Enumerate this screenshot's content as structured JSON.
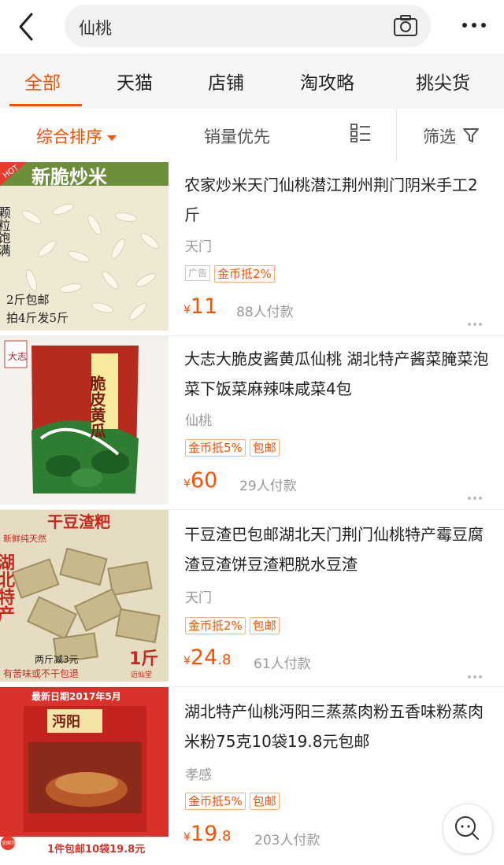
{
  "search": {
    "query": "仙桃"
  },
  "tabs": [
    {
      "label": "全部"
    },
    {
      "label": "天猫"
    },
    {
      "label": "店铺"
    },
    {
      "label": "淘攻略"
    },
    {
      "label": "挑尖货"
    }
  ],
  "sort": {
    "comprehensive": "综合排序",
    "sales": "销量优先",
    "filter": "筛选"
  },
  "products": [
    {
      "title": "农家炒米天门仙桃潜江荆州荆门阴米手工2斤",
      "location": "天门",
      "ad_tag": "广告",
      "tags": [
        "金币抵2%"
      ],
      "currency": "¥",
      "price_int": "11",
      "price_dec": "",
      "buyers": "88人付款",
      "img_text": {
        "title": "新脆炒米",
        "badge": "HOT",
        "side": "颗粒饱满",
        "bottom1": "2斤包邮",
        "bottom2": "拍4斤发5斤"
      }
    },
    {
      "title": "大志大脆皮酱黄瓜仙桃 湖北特产酱菜腌菜泡菜下饭菜麻辣味咸菜4包",
      "location": "仙桃",
      "tags": [
        "金币抵5%",
        "包邮"
      ],
      "currency": "¥",
      "price_int": "60",
      "price_dec": "",
      "buyers": "29人付款",
      "img_text": {
        "package": "脆皮黄瓜",
        "logo": "大志"
      }
    },
    {
      "title": "干豆渣巴包邮湖北天门荆门仙桃特产霉豆腐渣豆渣饼豆渣粑脱水豆渣",
      "location": "天门",
      "tags": [
        "金币抵2%",
        "包邮"
      ],
      "currency": "¥",
      "price_int": "24",
      "price_dec": ".8",
      "buyers": "61人付款",
      "img_text": {
        "title": "干豆渣粑",
        "side": "湖北特产",
        "top_small": "新鲜纯天然",
        "weight": "1斤",
        "promo": "两斤减3元",
        "note": "有苦味或不干包退",
        "shop": "迈仙堂"
      }
    },
    {
      "title": "湖北特产仙桃沔阳三蒸蒸肉粉五香味粉蒸肉米粉75克10袋19.8元包邮",
      "location": "孝感",
      "tags": [
        "金币抵5%",
        "包邮"
      ],
      "currency": "¥",
      "price_int": "19",
      "price_dec": ".8",
      "buyers": "203人付款",
      "img_text": {
        "top": "最新日期2017年5月",
        "brand": "沔阳",
        "bottom": "1件包邮10袋19.8元",
        "corner": "全国包邮"
      }
    }
  ],
  "colors": {
    "accent": "#ff5000",
    "tag_border": "#ffb07a",
    "muted": "#999999"
  },
  "icons": [
    "back-arrow-icon",
    "camera-icon",
    "more-icon",
    "layout-switch-icon",
    "filter-funnel-icon",
    "chat-bubble-icon"
  ]
}
